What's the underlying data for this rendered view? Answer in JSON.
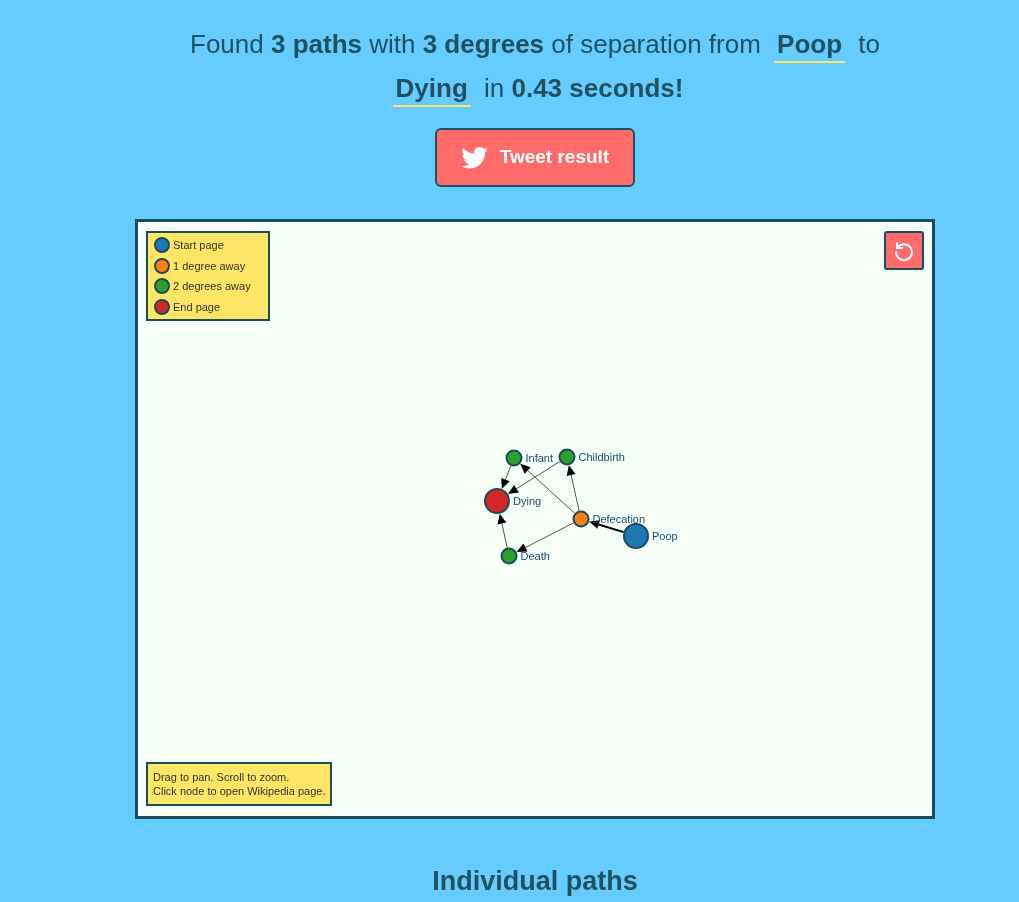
{
  "summary": {
    "parts": [
      {
        "kind": "text",
        "text": "Found **3 paths** with **3 degrees** of separation from"
      },
      {
        "kind": "link",
        "text": "Poop"
      },
      {
        "kind": "text",
        "text": "to"
      },
      {
        "kind": "link",
        "text": "Dying"
      },
      {
        "kind": "text",
        "text": "in **0.43 seconds!**"
      }
    ]
  },
  "tweet_button": {
    "label": "Tweet result"
  },
  "graph": {
    "legend": [
      {
        "label": "Start page",
        "color": "#1f77b4"
      },
      {
        "label": "1 degree away",
        "color": "#ff7f0e"
      },
      {
        "label": "2 degrees away",
        "color": "#2ca02c"
      },
      {
        "label": "End page",
        "color": "#d62728"
      }
    ],
    "nodes": [
      {
        "label": "Infant",
        "kind": "degree_2"
      },
      {
        "label": "Childbirth",
        "kind": "degree_2"
      },
      {
        "label": "Dying",
        "kind": "end"
      },
      {
        "label": "Defecation",
        "kind": "degree_1"
      },
      {
        "label": "Poop",
        "kind": "start"
      },
      {
        "label": "Death",
        "kind": "degree_2"
      }
    ],
    "help": [
      "Drag to pan. Scroll to zoom.",
      "Click node to open Wikipedia page."
    ]
  },
  "section_heading": "Individual paths"
}
